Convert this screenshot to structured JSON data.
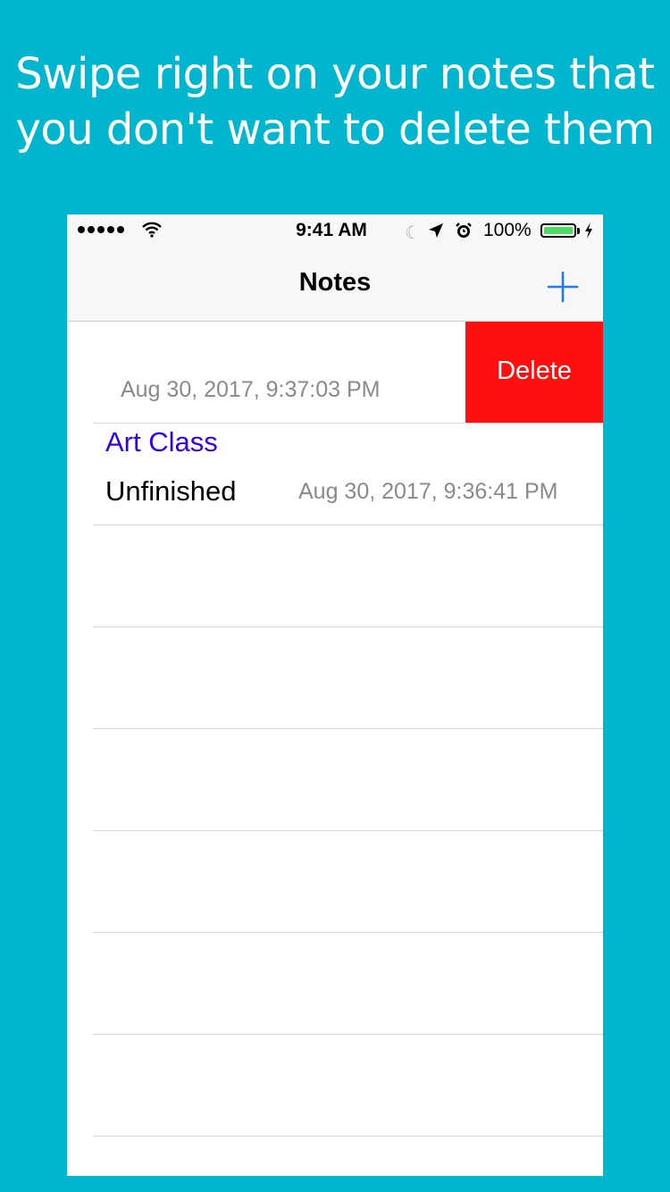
{
  "headline": {
    "line1": "Swipe right on your notes that",
    "line2": "you don't want to delete them"
  },
  "status_bar": {
    "time": "9:41 AM",
    "battery": "100%",
    "icons": [
      "signal-dots-icon",
      "wifi-icon",
      "moon-icon",
      "location-arrow-icon",
      "alarm-icon",
      "battery-icon",
      "charging-bolt-icon"
    ]
  },
  "nav": {
    "title": "Notes",
    "add_icon": "plus-icon"
  },
  "notes": [
    {
      "date": "Aug 30, 2017, 9:37:03 PM",
      "action": "Delete",
      "swiped": true
    },
    {
      "title": "Art Class",
      "status": "Unfinished",
      "date": "Aug 30, 2017, 9:36:41 PM"
    }
  ],
  "colors": {
    "background": "#00B5CE",
    "delete": "#FF1010",
    "note_title": "#3300EE",
    "accent": "#1E7CF2",
    "battery": "#4CD964"
  }
}
